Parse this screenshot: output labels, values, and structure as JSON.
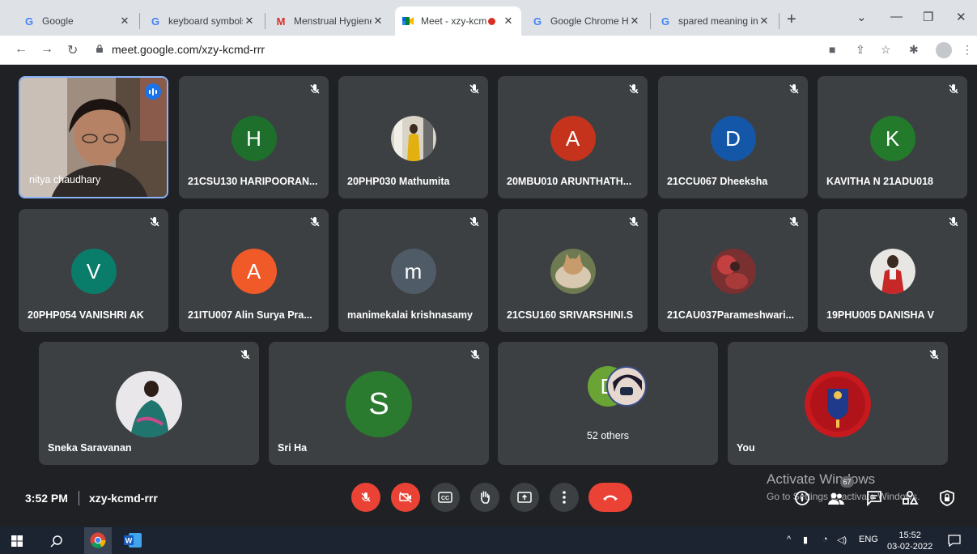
{
  "browser": {
    "tabs": [
      {
        "title": "Google",
        "favicon": "google-g-icon"
      },
      {
        "title": "keyboard symbols",
        "favicon": "google-g-icon"
      },
      {
        "title": "Menstrual Hygiene",
        "favicon": "gmail-m-icon"
      },
      {
        "title": "Meet - xzy-kcm",
        "favicon": "meet-icon",
        "active": true
      },
      {
        "title": "Google Chrome He",
        "favicon": "google-g-icon"
      },
      {
        "title": "spared meaning in",
        "favicon": "google-g-icon"
      }
    ],
    "url": "meet.google.com/xzy-kcmd-rrr"
  },
  "meet": {
    "row1": [
      {
        "name": "nitya chaudhary",
        "type": "video"
      },
      {
        "name": "21CSU130 HARIPOORAN...",
        "initial": "H",
        "color": "#1e6f2c"
      },
      {
        "name": "20PHP030 Mathumita",
        "type": "photo"
      },
      {
        "name": "20MBU010 ARUNTHATH...",
        "initial": "A",
        "color": "#c5331c"
      },
      {
        "name": "21CCU067 Dheeksha",
        "initial": "D",
        "color": "#1457a8"
      },
      {
        "name": "KAVITHA N 21ADU018",
        "initial": "K",
        "color": "#237a2b"
      }
    ],
    "row2": [
      {
        "name": "20PHP054 VANISHRI AK",
        "initial": "V",
        "color": "#0a7d6a"
      },
      {
        "name": "21ITU007 Alin Surya Pra...",
        "initial": "A",
        "color": "#f05a28"
      },
      {
        "name": "manimekalai krishnasamy",
        "initial": "m",
        "color": "#4f5b66"
      },
      {
        "name": "21CSU160 SRIVARSHINI.S",
        "type": "photo"
      },
      {
        "name": "21CAU037Parameshwari...",
        "type": "photo"
      },
      {
        "name": "19PHU005 DANISHA V",
        "type": "photo"
      }
    ],
    "row3": [
      {
        "name": "Sneka Saravanan",
        "type": "photo"
      },
      {
        "name": "Sri Ha",
        "initial": "S",
        "color": "#2a7a2f"
      },
      {
        "name": "52 others",
        "initial": "D",
        "color": "#6aa434"
      },
      {
        "name": "You",
        "type": "logo"
      }
    ]
  },
  "bottom_bar": {
    "time": "3:52 PM",
    "meeting_code": "xzy-kcmd-rrr",
    "participant_count": "67",
    "activate_title": "Activate Windows",
    "activate_subtitle": "Go to Settings to activate Windows."
  },
  "taskbar": {
    "lang": "ENG",
    "time": "15:52",
    "date": "03-02-2022"
  }
}
